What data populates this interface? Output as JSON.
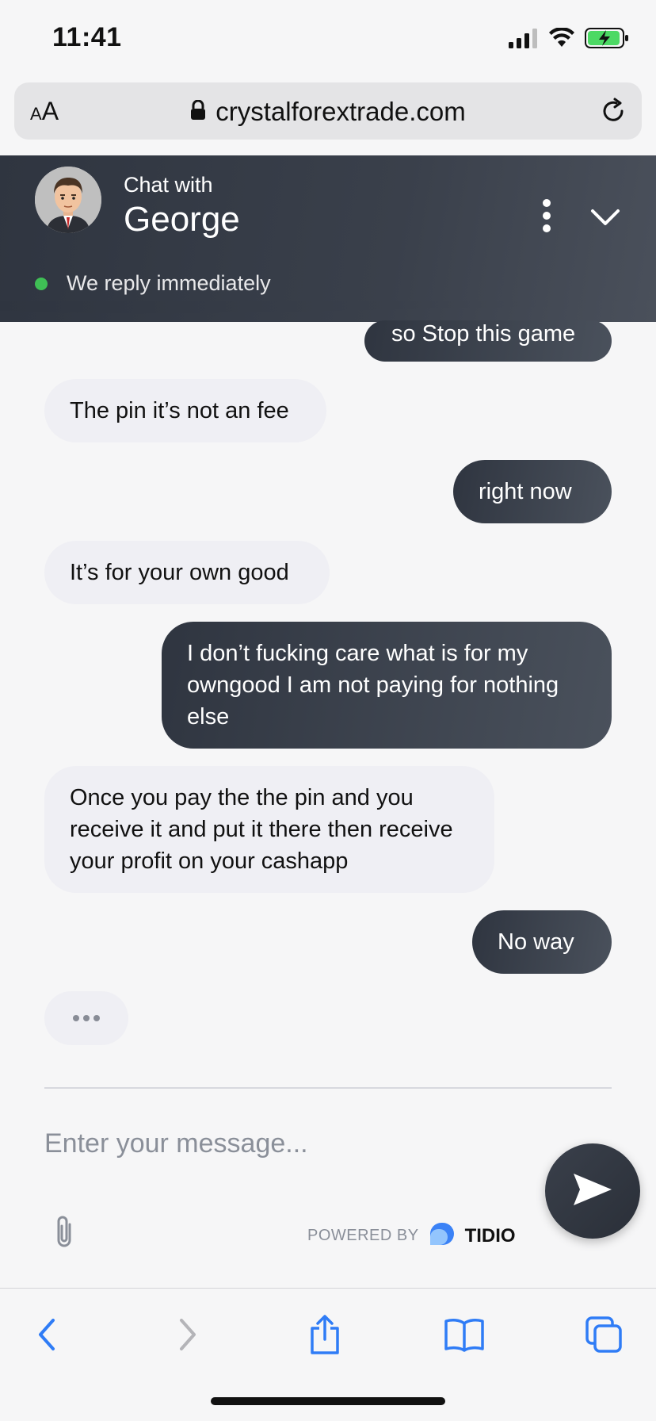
{
  "status_bar": {
    "time": "11:41"
  },
  "browser": {
    "aa_label_small": "A",
    "aa_label_large": "A",
    "url": "crystalforextrade.com"
  },
  "chat_header": {
    "chat_with": "Chat with",
    "agent_name": "George",
    "reply_status": "We reply immediately"
  },
  "messages": [
    {
      "from": "user",
      "lines": [
        "so Stop this game"
      ]
    },
    {
      "from": "agent",
      "lines": [
        "The pin it’s not an fee"
      ]
    },
    {
      "from": "user",
      "lines": [
        "right now"
      ]
    },
    {
      "from": "agent",
      "lines": [
        "It’s for your own good"
      ]
    },
    {
      "from": "user",
      "lines": [
        "I don’t fucking care what is for my",
        "owngood I am not paying for nothing",
        "else"
      ]
    },
    {
      "from": "agent",
      "lines": [
        "Once you pay the the pin and you",
        "receive it and put it there then receive",
        "your profit on your cashapp"
      ]
    },
    {
      "from": "user",
      "lines": [
        "No way"
      ]
    }
  ],
  "composer": {
    "placeholder": "Enter your message...",
    "powered_by": "POWERED BY",
    "brand": "TIDIO"
  },
  "colors": {
    "header_dark": "#2f3540",
    "online_green": "#3fbf55",
    "agent_bubble": "#efeff4",
    "ios_blue": "#2f7cf6",
    "tidio_blue": "#3b82f6"
  },
  "icons": {
    "status": [
      "signal-icon",
      "wifi-icon",
      "battery-charging-icon"
    ],
    "toolbar": [
      "back-icon",
      "forward-icon",
      "share-icon",
      "bookmarks-icon",
      "tabs-icon"
    ]
  }
}
